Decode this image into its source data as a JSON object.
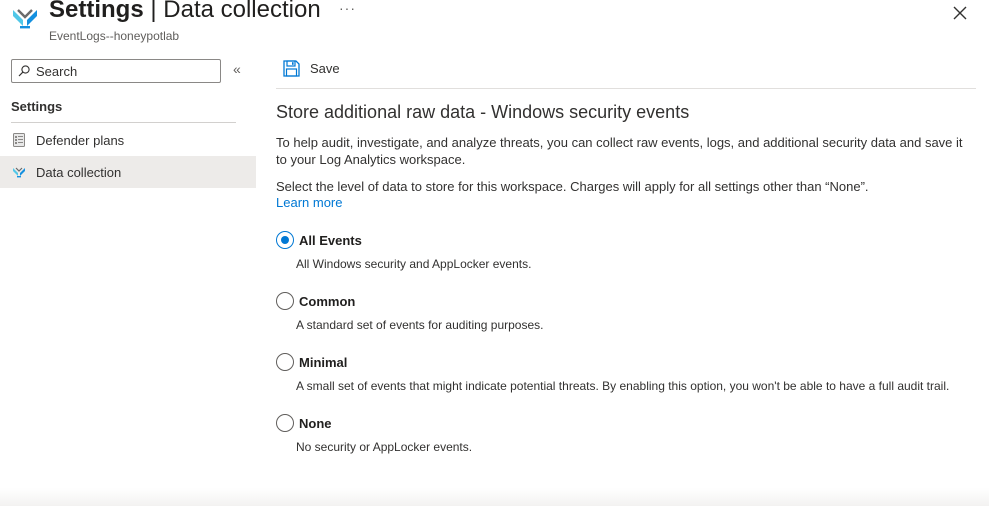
{
  "header": {
    "title_main": "Settings",
    "title_sep": " | ",
    "title_rest": "Data collection",
    "more_label": "···",
    "subtitle": "EventLogs--honeypotlab",
    "close_icon": "close-icon"
  },
  "sidebar": {
    "search_placeholder": "Search",
    "collapse_label": "«",
    "section_label": "Settings",
    "items": [
      {
        "label": "Defender plans",
        "icon": "defender-plans-icon",
        "active": false
      },
      {
        "label": "Data collection",
        "icon": "data-collection-icon",
        "active": true
      }
    ]
  },
  "toolbar": {
    "save_label": "Save",
    "save_icon": "save-icon"
  },
  "content": {
    "heading": "Store additional raw data - Windows security events",
    "paragraph1": "To help audit, investigate, and analyze threats, you can collect raw events, logs, and additional security data and save it to your Log Analytics workspace.",
    "paragraph2": "Select the level of data to store for this workspace. Charges will apply for all settings other than “None”.",
    "learn_more": "Learn more",
    "options": [
      {
        "label": "All Events",
        "description": "All Windows security and AppLocker events.",
        "selected": true
      },
      {
        "label": "Common",
        "description": "A standard set of events for auditing purposes.",
        "selected": false
      },
      {
        "label": "Minimal",
        "description": "A small set of events that might indicate potential threats. By enabling this option, you won't be able to have a full audit trail.",
        "selected": false
      },
      {
        "label": "None",
        "description": "No security or AppLocker events.",
        "selected": false
      }
    ]
  },
  "colors": {
    "accent": "#0078d4",
    "active_nav_bg": "#edebe9",
    "text": "#323130"
  }
}
